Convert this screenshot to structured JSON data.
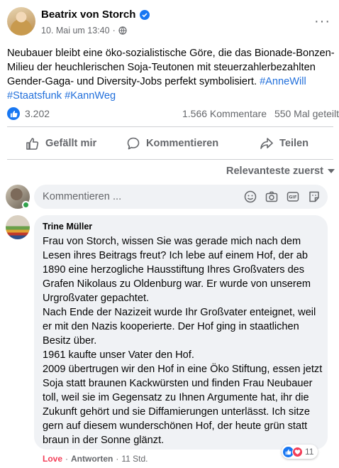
{
  "post": {
    "author": "Beatrix von Storch",
    "date": "10. Mai um 13:40",
    "separator": "·",
    "more": "···",
    "text_main": "Neubauer bleibt eine öko-sozialistische Göre, die das Bionade-Bonzen-Milieu der heuchlerischen Soja-Teutonen mit steuerzahlerbezahlten Gender-Gaga- und Diversity-Jobs perfekt symbolisiert. ",
    "hashtags": [
      "#AnneWill",
      "#Staatsfunk",
      "#KannWeg"
    ]
  },
  "stats": {
    "likes": "3.202",
    "comments": "1.566 Kommentare",
    "shares": "550 Mal geteilt"
  },
  "actions": {
    "like": "Gefällt mir",
    "comment": "Kommentieren",
    "share": "Teilen"
  },
  "sort": {
    "label": "Relevanteste zuerst"
  },
  "composer": {
    "placeholder": "Kommentieren ..."
  },
  "comment": {
    "author": "Trine Müller",
    "text": "Frau von Storch, wissen Sie was gerade mich nach dem Lesen ihres Beitrags freut? Ich lebe auf einem Hof, der ab 1890 eine herzogliche Hausstiftung Ihres Großvaters des Grafen Nikolaus zu Oldenburg war. Er wurde von unserem Urgroßvater gepachtet.\nNach Ende der Nazizeit wurde Ihr Großvater enteignet, weil er mit den Nazis kooperierte. Der Hof ging in staatlichen Besitz über.\n1961 kaufte unser Vater den Hof.\n2009 übertrugen wir den Hof in eine Öko Stiftung, essen jetzt Soja statt braunen Kackwürsten und finden Frau Neubauer toll, weil sie im Gegensatz zu Ihnen Argumente hat, ihr die Zukunft gehört und sie Diffamierungen unterlässt. Ich sitze gern auf diesem wunderschönen Hof, der heute grün statt braun in der Sonne glänzt.",
    "reaction_count": "11",
    "footer_love": "Love",
    "footer_reply": "Antworten",
    "footer_time": "11 Std.",
    "footer_sep": "·"
  },
  "colors": {
    "facebook_blue": "#1877f2",
    "hashtag": "#216fdb",
    "love": "#f33e58",
    "online": "#31a24c"
  },
  "icons": [
    "verified-icon",
    "globe-icon",
    "more-icon",
    "like-icon",
    "comment-icon",
    "share-icon",
    "emoji-icon",
    "camera-icon",
    "gif-icon",
    "sticker-icon",
    "love-icon"
  ]
}
